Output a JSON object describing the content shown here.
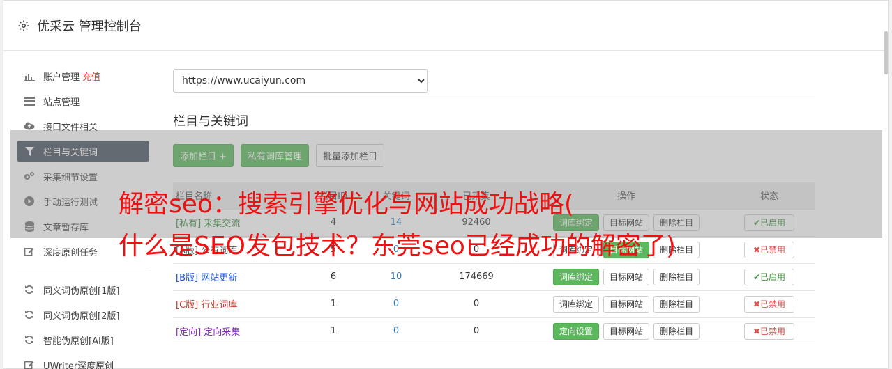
{
  "header": {
    "title": "优采云 管理控制台"
  },
  "sidebar": {
    "items": [
      {
        "label": "账户管理",
        "badge": "充值"
      },
      {
        "label": "站点管理"
      },
      {
        "label": "接口文件相关"
      },
      {
        "label": "栏目与关键词"
      },
      {
        "label": "采集细节设置"
      },
      {
        "label": "手动运行测试"
      },
      {
        "label": "文章暂存库"
      },
      {
        "label": "深度原创任务"
      }
    ],
    "items2": [
      {
        "label": "同义词伪原创[1版]"
      },
      {
        "label": "同义词伪原创[2版]"
      },
      {
        "label": "智能伪原创[AI版]"
      },
      {
        "label": "UWriter深度原创"
      }
    ]
  },
  "main": {
    "site_select": "https://www.ucaiyun.com",
    "section_title": "栏目与关键词",
    "buttons": {
      "add": "添加栏目 +",
      "private_lib": "私有词库管理",
      "batch_add": "批量添加栏目"
    },
    "columns": [
      "栏目名称",
      "栏目ID",
      "关键词",
      "已采集",
      "操作",
      "状态"
    ],
    "rows": [
      {
        "tag": "[私有]",
        "name": "采集交流",
        "id": "4",
        "kw": "14",
        "collected": "92460",
        "op1": "词库绑定",
        "op2": "目标网站",
        "op3": "删除栏目",
        "status": "✔已启用"
      },
      {
        "tag": "[A版]",
        "name": "公有词库",
        "id": "5",
        "kw": "0",
        "collected": "0",
        "op1": "词库绑定",
        "op2": "目标网站",
        "op3": "删除栏目",
        "status": "✖已禁用"
      },
      {
        "tag": "[B版]",
        "name": "网站更新",
        "id": "6",
        "kw": "10",
        "collected": "174669",
        "op1": "词库绑定",
        "op2": "目标网站",
        "op3": "删除栏目",
        "status": "✔已启用"
      },
      {
        "tag": "[C版]",
        "name": "行业词库",
        "id": "1",
        "kw": "0",
        "collected": "0",
        "op1": "词库绑定",
        "op2": "目标网站",
        "op3": "删除栏目",
        "status": "✖已禁用"
      },
      {
        "tag": "[定向]",
        "name": "定向采集",
        "id": "1",
        "kw": "0",
        "collected": "0",
        "op1": "定向设置",
        "op2": "目标网站",
        "op3": "删除栏目",
        "status": "✖已禁用"
      }
    ]
  },
  "overlay": {
    "line1": "解密seo：搜索引擎优化与网站成功战略(",
    "line2": "什么是SEO发包技术？东莞seo已经成功的解密了)"
  }
}
